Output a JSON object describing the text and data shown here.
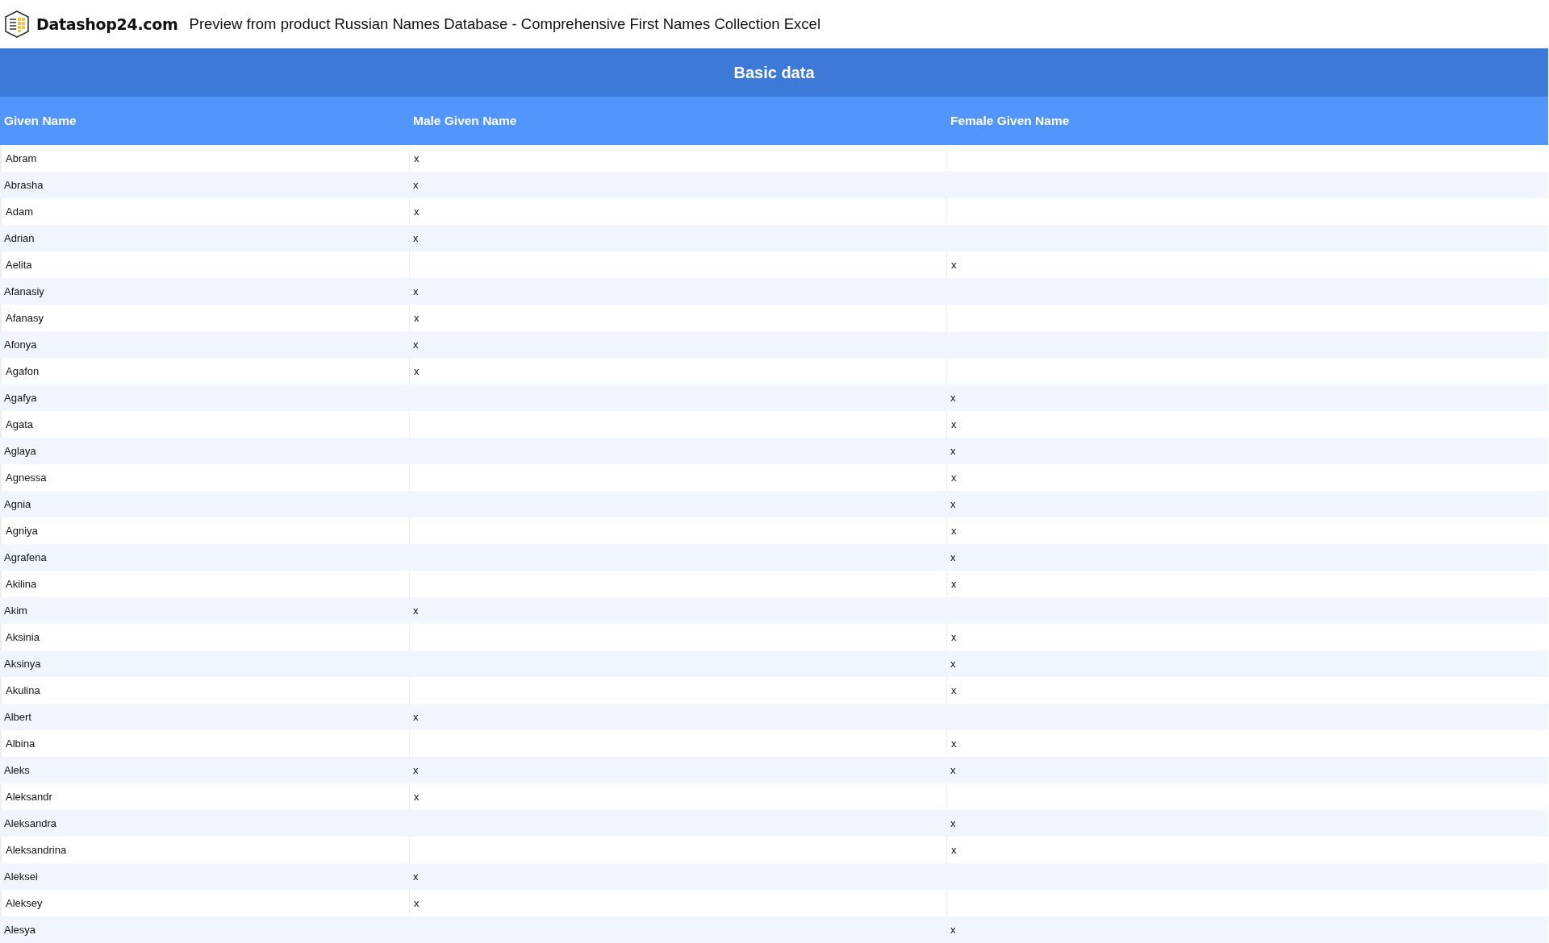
{
  "header": {
    "brand": "Datashop24.com",
    "title": "Preview from product Russian Names Database - Comprehensive First Names Collection Excel"
  },
  "table": {
    "caption": "Basic data",
    "columns": [
      "Given Name",
      "Male Given Name",
      "Female Given Name"
    ],
    "rows": [
      {
        "name": "Abram",
        "male": "x"
      },
      {
        "name": "Abrasha",
        "male": "x"
      },
      {
        "name": "Adam",
        "male": "x"
      },
      {
        "name": "Adrian",
        "male": "x"
      },
      {
        "name": "Aelita",
        "female": "x"
      },
      {
        "name": "Afanasiy",
        "male": "x"
      },
      {
        "name": "Afanasy",
        "male": "x"
      },
      {
        "name": "Afonya",
        "male": "x"
      },
      {
        "name": "Agafon",
        "male": "x"
      },
      {
        "name": "Agafya",
        "female": "x"
      },
      {
        "name": "Agata",
        "female": "x"
      },
      {
        "name": "Aglaya",
        "female": "x"
      },
      {
        "name": "Agnessa",
        "female": "x"
      },
      {
        "name": "Agnia",
        "female": "x"
      },
      {
        "name": "Agniya",
        "female": "x"
      },
      {
        "name": "Agrafena",
        "female": "x"
      },
      {
        "name": "Akilina",
        "female": "x"
      },
      {
        "name": "Akim",
        "male": "x"
      },
      {
        "name": "Aksinia",
        "female": "x"
      },
      {
        "name": "Aksinya",
        "female": "x"
      },
      {
        "name": "Akulina",
        "female": "x"
      },
      {
        "name": "Albert",
        "male": "x"
      },
      {
        "name": "Albina",
        "female": "x"
      },
      {
        "name": "Aleks",
        "male": "x",
        "female": "x"
      },
      {
        "name": "Aleksandr",
        "male": "x"
      },
      {
        "name": "Aleksandra",
        "female": "x"
      },
      {
        "name": "Aleksandrina",
        "female": "x"
      },
      {
        "name": "Aleksei",
        "male": "x"
      },
      {
        "name": "Aleksey",
        "male": "x"
      },
      {
        "name": "Alesya",
        "female": "x"
      }
    ]
  }
}
